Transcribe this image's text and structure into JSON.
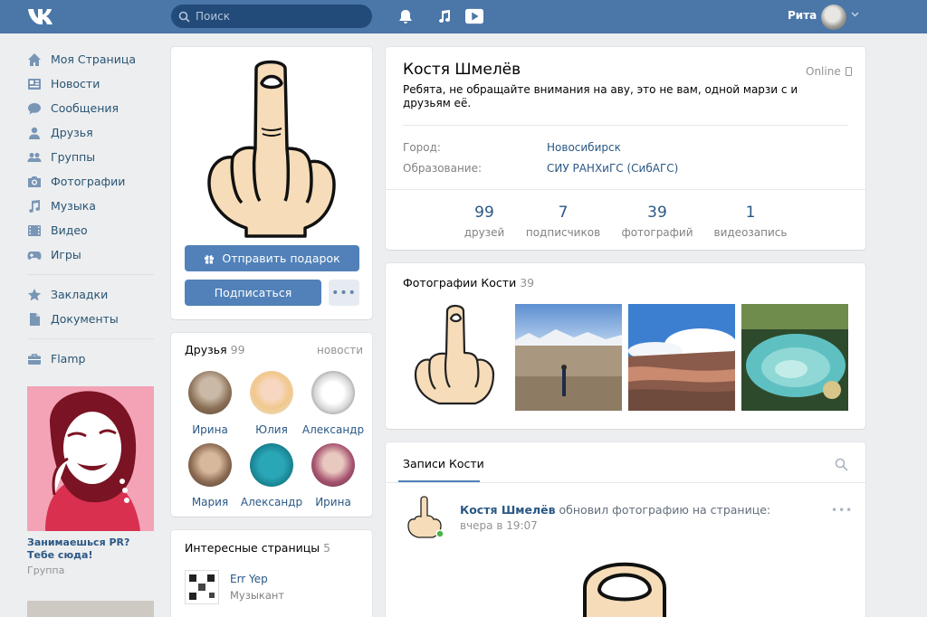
{
  "header": {
    "search_placeholder": "Поиск",
    "user_name": "Рита"
  },
  "nav": {
    "items": [
      {
        "label": "Моя Страница",
        "icon": "home-icon"
      },
      {
        "label": "Новости",
        "icon": "news-icon"
      },
      {
        "label": "Сообщения",
        "icon": "messages-icon"
      },
      {
        "label": "Друзья",
        "icon": "friends-icon"
      },
      {
        "label": "Группы",
        "icon": "groups-icon"
      },
      {
        "label": "Фотографии",
        "icon": "camera-icon"
      },
      {
        "label": "Музыка",
        "icon": "music-icon"
      },
      {
        "label": "Видео",
        "icon": "video-icon"
      },
      {
        "label": "Игры",
        "icon": "games-icon"
      }
    ],
    "items2": [
      {
        "label": "Закладки",
        "icon": "star-icon"
      },
      {
        "label": "Документы",
        "icon": "document-icon"
      }
    ],
    "items3": [
      {
        "label": "Flamp",
        "icon": "briefcase-icon"
      }
    ]
  },
  "ad": {
    "title": "Занимаешься PR? Тебе сюда!",
    "subtitle": "Группа"
  },
  "profile_actions": {
    "gift_label": "Отправить подарок",
    "subscribe_label": "Подписаться",
    "more_label": "•••"
  },
  "friends": {
    "title": "Друзья",
    "count": "99",
    "link": "новости",
    "list": [
      {
        "name": "Ирина"
      },
      {
        "name": "Юлия"
      },
      {
        "name": "Александр"
      },
      {
        "name": "Мария"
      },
      {
        "name": "Александр"
      },
      {
        "name": "Ирина"
      }
    ]
  },
  "interesting": {
    "title": "Интересные страницы",
    "count": "5",
    "item_name": "Err Yep",
    "item_desc": "Музыкант"
  },
  "profile": {
    "name": "Костя Шмелёв",
    "online": "Online",
    "status": "Ребята, не обращайте внимания на аву, это не вам, одной марзи с        и друзьям её.",
    "city_label": "Город:",
    "city_value": "Новосибирск",
    "edu_label": "Образование:",
    "edu_value": "СИУ РАНХиГС (СибАГС)"
  },
  "counters": [
    {
      "num": "99",
      "label": "друзей"
    },
    {
      "num": "7",
      "label": "подписчиков"
    },
    {
      "num": "39",
      "label": "фотографий"
    },
    {
      "num": "1",
      "label": "видеозапись"
    }
  ],
  "photos": {
    "title": "Фотографии Кости",
    "count": "39"
  },
  "wall": {
    "tab": "Записи Кости",
    "post_author": "Костя Шмелёв",
    "post_action": "обновил фотографию на странице:",
    "post_time": "вчера в 19:07",
    "post_more": "•••"
  },
  "colors": {
    "header": "#4a76a8",
    "link": "#2a5885",
    "button": "#5181b8",
    "background": "#edeef0"
  }
}
